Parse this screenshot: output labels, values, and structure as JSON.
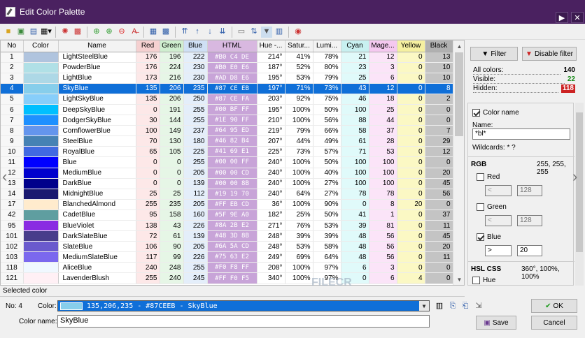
{
  "window": {
    "title": "Edit Color Palette",
    "next_btn": "▶",
    "close_btn": "✕"
  },
  "toolbar": {
    "icons": [
      "open-icon",
      "new-icon",
      "save-icon",
      "view-icon",
      "refresh-icon",
      "settings-icon",
      "add-icon",
      "add-copy-icon",
      "remove-icon",
      "clear-icon",
      "grid-small-icon",
      "grid-large-icon",
      "move-top-icon",
      "move-up-icon",
      "move-down-icon",
      "move-bottom-icon",
      "compare-icon",
      "sort-icon",
      "filter-icon",
      "columns-icon",
      "palette-icon"
    ]
  },
  "table": {
    "columns": [
      "No",
      "Color",
      "Name",
      "Red",
      "Green",
      "Blue",
      "HTML",
      "Hue -...",
      "Satur...",
      "Lumi...",
      "Cyan",
      "Mage...",
      "Yellow",
      "Black"
    ],
    "header_colors": [
      "#f3f3f3",
      "#f3f3f3",
      "#f3f3f3",
      "#f5d0d0",
      "#cfeecf",
      "#cfe0f5",
      "#d8b8e0",
      "#f3f3f3",
      "#f3f3f3",
      "#f3f3f3",
      "#c8f0f0",
      "#f5c8f0",
      "#f5f0a0",
      "#b0b0b0"
    ],
    "rows": [
      {
        "no": "1",
        "hex": "#B0C4DE",
        "name": "LightSteelBlue",
        "r": "176",
        "g": "196",
        "b": "222",
        "html": "#B0 C4 DE",
        "h": "214°",
        "s": "41%",
        "l": "78%",
        "c": "21",
        "m": "12",
        "y": "0",
        "k": "13"
      },
      {
        "no": "2",
        "hex": "#B0E0E6",
        "name": "PowderBlue",
        "r": "176",
        "g": "224",
        "b": "230",
        "html": "#B0 E0 E6",
        "h": "187°",
        "s": "52%",
        "l": "80%",
        "c": "23",
        "m": "3",
        "y": "0",
        "k": "10"
      },
      {
        "no": "3",
        "hex": "#ADD8E6",
        "name": "LightBlue",
        "r": "173",
        "g": "216",
        "b": "230",
        "html": "#AD D8 E6",
        "h": "195°",
        "s": "53%",
        "l": "79%",
        "c": "25",
        "m": "6",
        "y": "0",
        "k": "10"
      },
      {
        "no": "4",
        "hex": "#87CEEB",
        "name": "SkyBlue",
        "r": "135",
        "g": "206",
        "b": "235",
        "html": "#87 CE EB",
        "h": "197°",
        "s": "71%",
        "l": "73%",
        "c": "43",
        "m": "12",
        "y": "0",
        "k": "8",
        "sel": true
      },
      {
        "no": "5",
        "hex": "#87CEFA",
        "name": "LightSkyBlue",
        "r": "135",
        "g": "206",
        "b": "250",
        "html": "#87 CE FA",
        "h": "203°",
        "s": "92%",
        "l": "75%",
        "c": "46",
        "m": "18",
        "y": "0",
        "k": "2"
      },
      {
        "no": "6",
        "hex": "#00BFFF",
        "name": "DeepSkyBlue",
        "r": "0",
        "g": "191",
        "b": "255",
        "html": "#00 BF FF",
        "h": "195°",
        "s": "100%",
        "l": "50%",
        "c": "100",
        "m": "25",
        "y": "0",
        "k": "0"
      },
      {
        "no": "7",
        "hex": "#1E90FF",
        "name": "DodgerSkyBlue",
        "r": "30",
        "g": "144",
        "b": "255",
        "html": "#1E 90 FF",
        "h": "210°",
        "s": "100%",
        "l": "56%",
        "c": "88",
        "m": "44",
        "y": "0",
        "k": "0"
      },
      {
        "no": "8",
        "hex": "#6495ED",
        "name": "CornflowerBlue",
        "r": "100",
        "g": "149",
        "b": "237",
        "html": "#64 95 ED",
        "h": "219°",
        "s": "79%",
        "l": "66%",
        "c": "58",
        "m": "37",
        "y": "0",
        "k": "7"
      },
      {
        "no": "9",
        "hex": "#4682B4",
        "name": "SteelBlue",
        "r": "70",
        "g": "130",
        "b": "180",
        "html": "#46 82 B4",
        "h": "207°",
        "s": "44%",
        "l": "49%",
        "c": "61",
        "m": "28",
        "y": "0",
        "k": "29"
      },
      {
        "no": "10",
        "hex": "#4169E1",
        "name": "RoyalBlue",
        "r": "65",
        "g": "105",
        "b": "225",
        "html": "#41 69 E1",
        "h": "225°",
        "s": "73%",
        "l": "57%",
        "c": "71",
        "m": "53",
        "y": "0",
        "k": "12"
      },
      {
        "no": "11",
        "hex": "#0000FF",
        "name": "Blue",
        "r": "0",
        "g": "0",
        "b": "255",
        "html": "#00 00 FF",
        "h": "240°",
        "s": "100%",
        "l": "50%",
        "c": "100",
        "m": "100",
        "y": "0",
        "k": "0"
      },
      {
        "no": "12",
        "hex": "#0000CD",
        "name": "MediumBlue",
        "r": "0",
        "g": "0",
        "b": "205",
        "html": "#00 00 CD",
        "h": "240°",
        "s": "100%",
        "l": "40%",
        "c": "100",
        "m": "100",
        "y": "0",
        "k": "20"
      },
      {
        "no": "13",
        "hex": "#00008B",
        "name": "DarkBlue",
        "r": "0",
        "g": "0",
        "b": "139",
        "html": "#00 00 8B",
        "h": "240°",
        "s": "100%",
        "l": "27%",
        "c": "100",
        "m": "100",
        "y": "0",
        "k": "45"
      },
      {
        "no": "14",
        "hex": "#191970",
        "name": "MidnightBlue",
        "r": "25",
        "g": "25",
        "b": "112",
        "html": "#19 19 70",
        "h": "240°",
        "s": "64%",
        "l": "27%",
        "c": "78",
        "m": "78",
        "y": "0",
        "k": "56"
      },
      {
        "no": "17",
        "hex": "#FFEBCD",
        "name": "BlanchedAlmond",
        "r": "255",
        "g": "235",
        "b": "205",
        "html": "#FF EB CD",
        "h": "36°",
        "s": "100%",
        "l": "90%",
        "c": "0",
        "m": "8",
        "y": "20",
        "k": "0"
      },
      {
        "no": "42",
        "hex": "#5F9EA0",
        "name": "CadetBlue",
        "r": "95",
        "g": "158",
        "b": "160",
        "html": "#5F 9E A0",
        "h": "182°",
        "s": "25%",
        "l": "50%",
        "c": "41",
        "m": "1",
        "y": "0",
        "k": "37"
      },
      {
        "no": "95",
        "hex": "#8A2BE2",
        "name": "BlueViolet",
        "r": "138",
        "g": "43",
        "b": "226",
        "html": "#8A 2B E2",
        "h": "271°",
        "s": "76%",
        "l": "53%",
        "c": "39",
        "m": "81",
        "y": "0",
        "k": "11"
      },
      {
        "no": "101",
        "hex": "#483D8B",
        "name": "DarkSlateBlue",
        "r": "72",
        "g": "61",
        "b": "139",
        "html": "#48 3D 8B",
        "h": "248°",
        "s": "39%",
        "l": "39%",
        "c": "48",
        "m": "56",
        "y": "0",
        "k": "45"
      },
      {
        "no": "102",
        "hex": "#6A5ACD",
        "name": "SlateBlue",
        "r": "106",
        "g": "90",
        "b": "205",
        "html": "#6A 5A CD",
        "h": "248°",
        "s": "53%",
        "l": "58%",
        "c": "48",
        "m": "56",
        "y": "0",
        "k": "20"
      },
      {
        "no": "103",
        "hex": "#7B68EE",
        "name": "MediumSlateBlue",
        "r": "117",
        "g": "99",
        "b": "226",
        "html": "#75 63 E2",
        "h": "249°",
        "s": "69%",
        "l": "64%",
        "c": "48",
        "m": "56",
        "y": "0",
        "k": "11"
      },
      {
        "no": "118",
        "hex": "#F0F8FF",
        "name": "AliceBlue",
        "r": "240",
        "g": "248",
        "b": "255",
        "html": "#F0 F8 FF",
        "h": "208°",
        "s": "100%",
        "l": "97%",
        "c": "6",
        "m": "3",
        "y": "0",
        "k": "0"
      },
      {
        "no": "121",
        "hex": "#FFF0F5",
        "name": "LavenderBlush",
        "r": "255",
        "g": "240",
        "b": "245",
        "html": "#FF F0 F5",
        "h": "340°",
        "s": "100%",
        "l": "97%",
        "c": "0",
        "m": "6",
        "y": "4",
        "k": "0"
      }
    ]
  },
  "filter": {
    "filter_label": "Filter",
    "disable_label": "Disable filter",
    "all_label": "All colors:",
    "all_val": "140",
    "visible_label": "Visible:",
    "visible_val": "22",
    "hidden_label": "Hidden:",
    "hidden_val": "118",
    "colorname_label": "Color name",
    "name_label": "Name:",
    "name_value": "*bl*",
    "wildcards": "Wildcards: * ?",
    "rgb_label": "RGB",
    "rgb_value": "255, 255, 255",
    "red_label": "Red",
    "red_op": "<",
    "red_val": "128",
    "green_label": "Green",
    "green_op": "<",
    "green_val": "128",
    "blue_label": "Blue",
    "blue_op": ">",
    "blue_val": "20",
    "hsl_label": "HSL CSS",
    "hsl_value": "360°, 100%, 100%",
    "hue_label": "Hue"
  },
  "bottom": {
    "section": "Selected color",
    "no_label": "No:",
    "no_val": "4",
    "color_label": "Color:",
    "color_value": "135,206,235 - #87CEEB - SkyBlue",
    "colorname_label": "Color name:",
    "colorname_value": "SkyBlue",
    "ok": "OK",
    "save": "Save",
    "cancel": "Cancel"
  },
  "watermark": "FILECR"
}
